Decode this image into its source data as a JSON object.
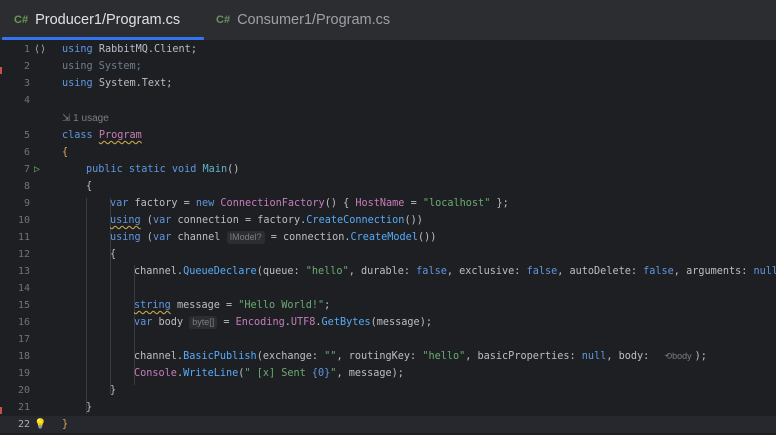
{
  "tabs": [
    {
      "icon_text": "C#",
      "label": "Producer1/Program.cs",
      "active": true
    },
    {
      "icon_text": "C#",
      "label": "Consumer1/Program.cs",
      "active": false
    }
  ],
  "usage_hint": "1 usage",
  "hints": {
    "channel_type": "IModel?",
    "body_type": "byte[]",
    "body_ref": "body"
  },
  "lines": {
    "l1": {
      "n": "1"
    },
    "l2": {
      "n": "2"
    },
    "l3": {
      "n": "3"
    },
    "l4": {
      "n": "4"
    },
    "l5": {
      "n": "5"
    },
    "l6": {
      "n": "6"
    },
    "l7": {
      "n": "7"
    },
    "l8": {
      "n": "8"
    },
    "l9": {
      "n": "9"
    },
    "l10": {
      "n": "10"
    },
    "l11": {
      "n": "11"
    },
    "l12": {
      "n": "12"
    },
    "l13": {
      "n": "13"
    },
    "l14": {
      "n": "14"
    },
    "l15": {
      "n": "15"
    },
    "l16": {
      "n": "16"
    },
    "l17": {
      "n": "17"
    },
    "l18": {
      "n": "18"
    },
    "l19": {
      "n": "19"
    },
    "l20": {
      "n": "20"
    },
    "l21": {
      "n": "21"
    },
    "l22": {
      "n": "22"
    }
  },
  "code": {
    "using": "using",
    "rabbit_ns": "RabbitMQ.Client",
    "system_line": "using System;",
    "system_text_ns": "System.Text",
    "semi": ";",
    "class_kw": "class",
    "program": "Program",
    "open_brace": "{",
    "close_brace": "}",
    "public_static_void": "public static void",
    "main": "Main",
    "parens": "()",
    "var": "var",
    "factory_assign": " factory = ",
    "new": "new",
    "conn_factory": "ConnectionFactory",
    "obj_init_open": "() { ",
    "host_name": "HostName",
    "assign_eq": " = ",
    "localhost": "\"localhost\"",
    "obj_init_close": " };",
    "using_open": " (",
    "connection_decl": " connection = factory.",
    "create_connection": "CreateConnection",
    "close_paren2": "())",
    "channel_decl": " channel",
    "connection_dot": " = connection.",
    "create_model": "CreateModel",
    "channel_dot": "channel.",
    "queue_declare": "QueueDeclare",
    "qd_queue": "(queue: ",
    "hello": "\"hello\"",
    "qd_durable": ", durable: ",
    "false": "false",
    "qd_exclusive": ", exclusive: ",
    "qd_autodelete": ", autoDelete: ",
    "qd_arguments": ", arguments: ",
    "null": "null",
    "close_semi": ");",
    "string_kw": "string",
    "message_decl": " message = ",
    "hello_world": "\"Hello World!\"",
    "body_decl": " body",
    "encoding": "Encoding",
    "utf8": "UTF8",
    "get_bytes": "GetBytes",
    "message_arg": "(message);",
    "basic_publish": "BasicPublish",
    "bp_exchange": "(exchange: ",
    "empty_str": "\"\"",
    "bp_routing": ", routingKey: ",
    "bp_props": ", basicProperties: ",
    "bp_body": ", body: ",
    "console": "Console",
    "write_line": "WriteLine",
    "open_paren": "(",
    "sent_str_a": "\" [x] Sent ",
    "sent_fmt": "{0}",
    "sent_str_b": "\"",
    "message_tail": ", message);",
    "dot": "."
  }
}
